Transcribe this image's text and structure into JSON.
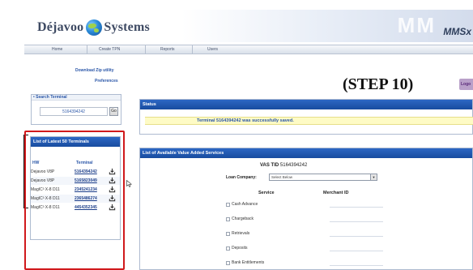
{
  "header": {
    "brand_left": "Déjavoo",
    "brand_right": "Systems",
    "watermark": "MM",
    "product": "MMSx"
  },
  "nav": {
    "items": [
      "Home",
      "Create TPN",
      "Reports",
      "Users"
    ]
  },
  "sidebar": {
    "download_link": "Download Zip utility",
    "preferences_link": "Preferences",
    "search": {
      "title": "• Search Terminal",
      "value": "5164394242",
      "go_label": "Go"
    },
    "latest": {
      "title": "List of Latest 50 Terminals",
      "col_hw": "HW",
      "col_terminal": "Terminal",
      "rows": [
        {
          "hw": "Dejavoo V8P",
          "terminal": "5164394242"
        },
        {
          "hw": "Dejavoo V8P",
          "terminal": "5165823049"
        },
        {
          "hw": "MagIC³ X-8 D11",
          "terminal": "2345241234"
        },
        {
          "hw": "MagIC³ X-8 D11",
          "terminal": "2365486274"
        },
        {
          "hw": "MagIC³ X-8 D11",
          "terminal": "4454352345"
        }
      ]
    }
  },
  "annotation": {
    "step": "(STEP 10)",
    "logout_tab": "Logo"
  },
  "status": {
    "title": "Status",
    "message": "Terminal 5164394242 was successfully saved."
  },
  "vas": {
    "title": "List of Available Value Added Services",
    "tid_label": "VAS TID",
    "tid_value": "5164394242",
    "loan_label": "Loan Company:",
    "loan_selected": "Select Below",
    "col_service": "Service",
    "col_merchant": "Merchant ID",
    "services": [
      "Cash Advance",
      "Chargeback",
      "Retrievals",
      "Deposits",
      "Bank Entitlements"
    ]
  },
  "colors": {
    "panel_header": "#184c9f",
    "highlight_box": "#d0191c",
    "status_bg": "#fefbc5"
  }
}
